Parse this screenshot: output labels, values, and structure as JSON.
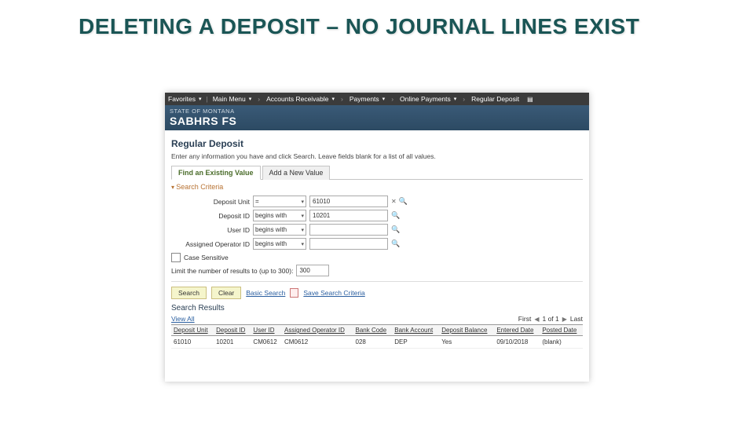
{
  "slide": {
    "title": "DELETING A DEPOSIT – NO JOURNAL LINES EXIST"
  },
  "nav": {
    "favorites": "Favorites",
    "main_menu": "Main Menu",
    "crumbs": [
      "Accounts Receivable",
      "Payments",
      "Online Payments",
      "Regular Deposit"
    ]
  },
  "banner": {
    "small": "STATE OF MONTANA",
    "large": "SABHRS FS"
  },
  "page": {
    "heading": "Regular Deposit",
    "instructions": "Enter any information you have and click Search. Leave fields blank for a list of all values."
  },
  "tabs": {
    "existing": "Find an Existing Value",
    "add": "Add a New Value"
  },
  "criteria": {
    "section_label": "Search Criteria",
    "rows": [
      {
        "label": "Deposit Unit",
        "op": "= ",
        "value": "61010",
        "has_x": true
      },
      {
        "label": "Deposit ID",
        "op": "begins with",
        "value": "10201",
        "has_x": false
      },
      {
        "label": "User ID",
        "op": "begins with",
        "value": "",
        "has_x": false
      },
      {
        "label": "Assigned Operator ID",
        "op": "begins with",
        "value": "",
        "has_x": false
      }
    ],
    "case_sensitive": "Case Sensitive",
    "limit_label": "Limit the number of results to (up to 300):",
    "limit_value": "300"
  },
  "buttons": {
    "search": "Search",
    "clear": "Clear",
    "basic": "Basic Search",
    "save_criteria": "Save Search Criteria"
  },
  "results": {
    "section_label": "Search Results",
    "view_all": "View All",
    "first": "First",
    "count": "1 of 1",
    "last": "Last",
    "columns": [
      "Deposit Unit",
      "Deposit ID",
      "User ID",
      "Assigned Operator ID",
      "Bank Code",
      "Bank Account",
      "Deposit Balance",
      "Entered Date",
      "Posted Date"
    ],
    "row": [
      "61010",
      "10201",
      "CM0612",
      "CM0612",
      "028",
      "DEP",
      "Yes",
      "09/10/2018",
      "(blank)"
    ]
  }
}
